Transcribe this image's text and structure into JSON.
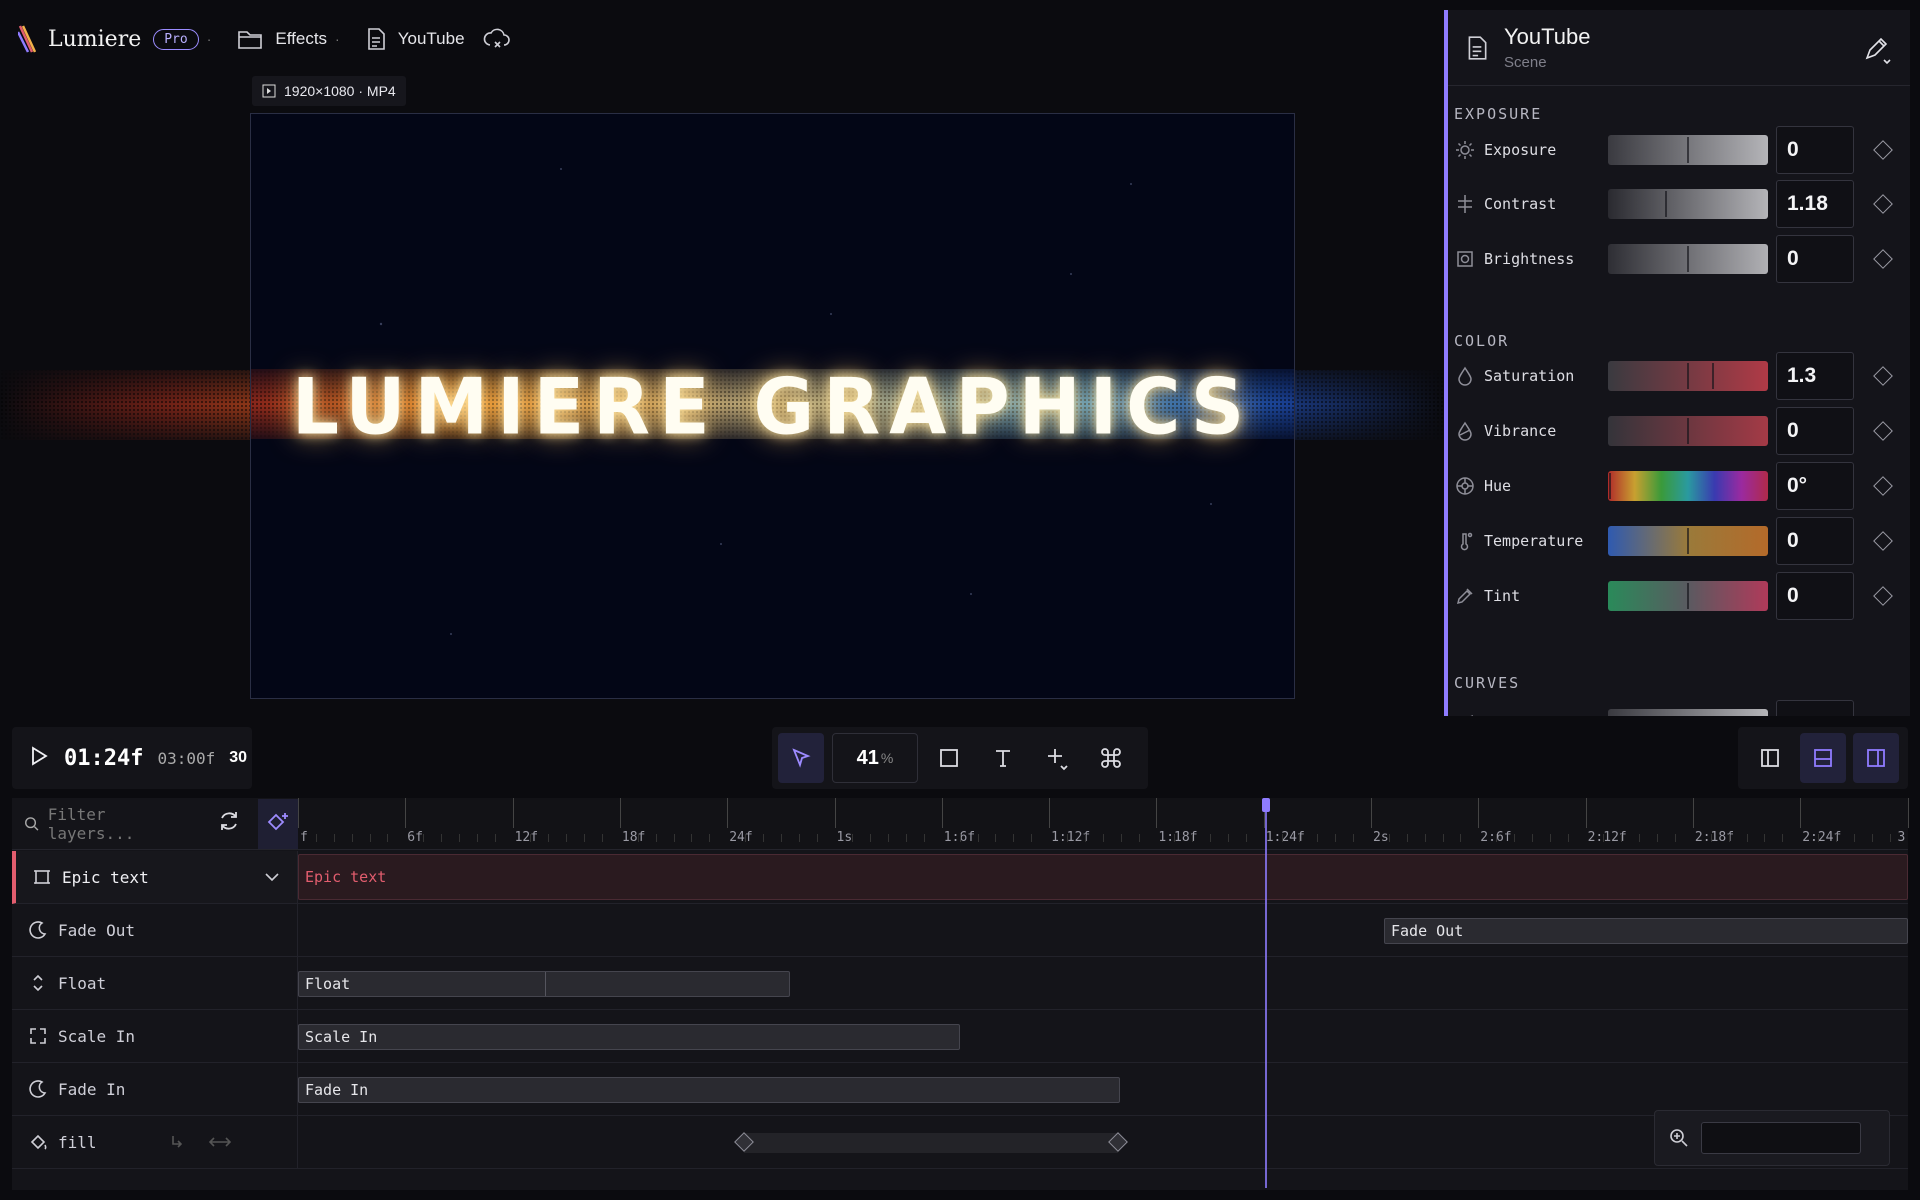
{
  "app": {
    "name": "Lumiere",
    "badge": "Pro"
  },
  "breadcrumb": {
    "folder": "Effects",
    "file": "YouTube"
  },
  "canvas": {
    "resolution_label": "1920×1080 · MP4",
    "title_text": "LUMIERE GRAPHICS"
  },
  "panel": {
    "title": "YouTube",
    "subtitle": "Scene",
    "sections": {
      "exposure": "EXPOSURE",
      "color": "COLOR",
      "curves": "CURVES"
    },
    "rows": [
      {
        "icon": "sun-icon",
        "label": "Exposure",
        "value": "0",
        "level": 0.5
      },
      {
        "icon": "contrast-icon",
        "label": "Contrast",
        "value": "1.18",
        "level": 0.36
      },
      {
        "icon": "brightness-icon",
        "label": "Brightness",
        "value": "0",
        "level": 0.5
      },
      {
        "icon": "drop-icon",
        "label": "Saturation",
        "value": "1.3",
        "level": 0.65
      },
      {
        "icon": "drop-half-icon",
        "label": "Vibrance",
        "value": "0",
        "level": 0.5
      },
      {
        "icon": "hue-wheel-icon",
        "label": "Hue",
        "value": "0°",
        "level": 0
      },
      {
        "icon": "thermometer-icon",
        "label": "Temperature",
        "value": "0",
        "level": 0.5
      },
      {
        "icon": "eyedropper-icon",
        "label": "Tint",
        "value": "0",
        "level": 0.5
      }
    ]
  },
  "transport": {
    "timecode": "01:24f",
    "duration": "03:00f",
    "fps": "30"
  },
  "toolbar": {
    "zoom": "41",
    "zoom_unit": "%"
  },
  "timeline": {
    "filter_placeholder": "Filter layers...",
    "ruler": [
      "f",
      "6f",
      "12f",
      "18f",
      "24f",
      "1s",
      "1:6f",
      "1:12f",
      "1:18f",
      "1:24f",
      "2s",
      "2:6f",
      "2:12f",
      "2:18f",
      "2:24f",
      "3"
    ],
    "layers": [
      {
        "name": "Epic text",
        "icon": "frame-icon"
      },
      {
        "name": "Fade Out",
        "icon": "moon-icon"
      },
      {
        "name": "Float",
        "icon": "float-icon"
      },
      {
        "name": "Scale In",
        "icon": "expand-icon"
      },
      {
        "name": "Fade In",
        "icon": "moon-icon"
      },
      {
        "name": "fill",
        "icon": "paint-bucket-icon"
      }
    ],
    "clips": {
      "epic": "Epic text",
      "fade_out": "Fade Out",
      "float": "Float",
      "scale_in": "Scale In",
      "fade_in": "Fade In"
    }
  },
  "colors": {
    "accent": "#8f7cff",
    "main_layer": "#e25d6e"
  }
}
